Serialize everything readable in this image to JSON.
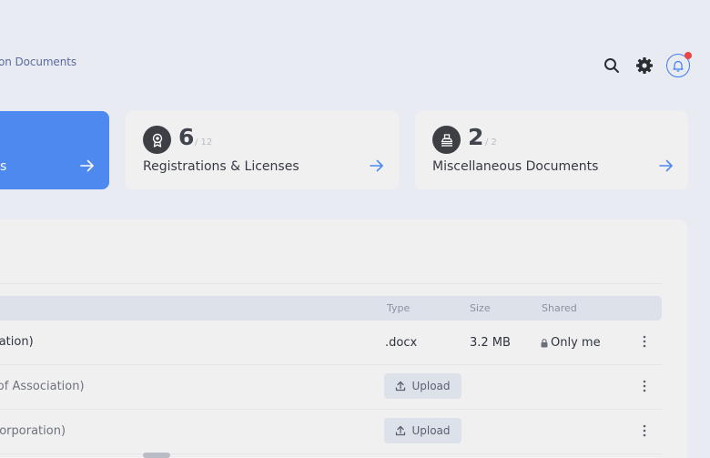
{
  "breadcrumb": {
    "current": "on Documents"
  },
  "topbar": {
    "search_icon": "search-icon",
    "settings_icon": "gear-icon",
    "notification_icon": "bell-icon",
    "notification_dot_color": "#e94545"
  },
  "cards": [
    {
      "id": "active",
      "title": "ents",
      "active": true,
      "color": "#4e89f0"
    },
    {
      "id": "registrations",
      "count": "6",
      "total": "/ 12",
      "title": "Registrations & Licenses",
      "icon": "award-icon"
    },
    {
      "id": "misc",
      "count": "2",
      "total": "/ 2",
      "title": "Miscellaneous Documents",
      "icon": "stamp-icon"
    }
  ],
  "table": {
    "headers": {
      "type": "Type",
      "size": "Size",
      "shared": "Shared"
    },
    "rows": [
      {
        "name": "ociation)",
        "type": ".docx",
        "size": "3.2 MB",
        "shared": "Only me"
      },
      {
        "name": "m of Association)",
        "upload_label": "Upload"
      },
      {
        "name": "Incorporation)",
        "upload_label": "Upload"
      }
    ]
  }
}
